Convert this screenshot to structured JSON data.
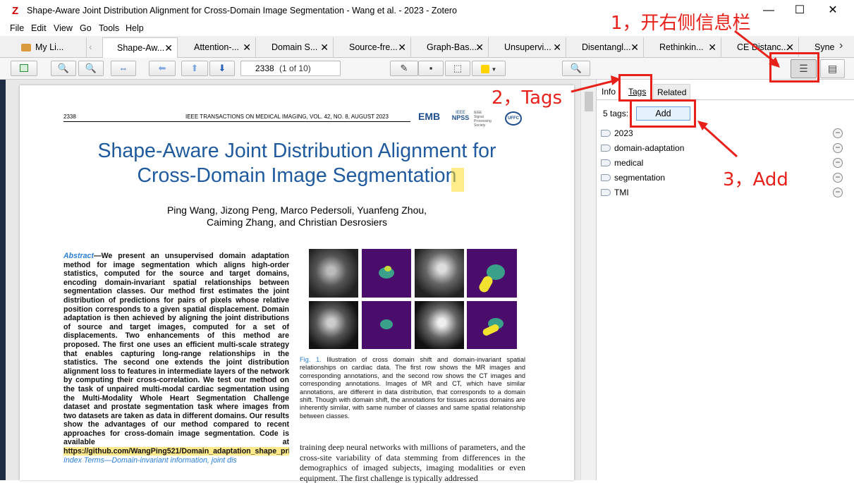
{
  "window": {
    "title": "Shape-Aware Joint Distribution Alignment for Cross-Domain Image Segmentation - Wang et al. - 2023 - Zotero",
    "app_icon": "zotero-z-icon",
    "minimize": "—",
    "maximize": "☐",
    "close": "✕"
  },
  "menu": [
    "File",
    "Edit",
    "View",
    "Go",
    "Tools",
    "Help"
  ],
  "tabs": [
    {
      "label": "My Li...",
      "icon": "library-icon"
    },
    {
      "label": "Shape-Aw...",
      "close": "✕"
    },
    {
      "label": "Attention-...",
      "close": "✕"
    },
    {
      "label": "Domain S...",
      "close": "✕"
    },
    {
      "label": "Source-fre...",
      "close": "✕"
    },
    {
      "label": "Graph-Bas...",
      "close": "✕"
    },
    {
      "label": "Unsupervi...",
      "close": "✕"
    },
    {
      "label": "Disentangl...",
      "close": "✕"
    },
    {
      "label": "Rethinkin...",
      "close": "✕"
    },
    {
      "label": "CE Distanc...",
      "close": "✕"
    },
    {
      "label": "Syne",
      "close": ""
    }
  ],
  "toolbar": {
    "page_value": "2338",
    "page_of": "(1 of 10)",
    "highlight_color": "#ffd400"
  },
  "pdf": {
    "header_left": "2338",
    "header_right": "IEEE TRANSACTIONS ON MEDICAL IMAGING, VOL. 42, NO. 8, AUGUST 2023",
    "logo_emb": "EMB",
    "logo_npss": "NPSS",
    "logo_ieee": "IEEE",
    "logo_sp": "Signal Processing Society",
    "logo_uffc": "UFFC",
    "title_line1": "Shape-Aware Joint Distribution Alignment for",
    "title_line2": "Cross-Domain Image Segmentation",
    "authors_line1": "Ping Wang, Jizong Peng, Marco Pedersoli, Yuanfeng Zhou,",
    "authors_line2": "Caiming Zhang, and Christian Desrosiers",
    "abstract_label": "Abstract",
    "abstract_text": "—We present an unsupervised domain adaptation method for image segmentation which aligns high-order statistics, computed for the source and target domains, encoding domain-invariant spatial relationships between segmentation classes. Our method first estimates the joint distribution of predictions for pairs of pixels whose relative position corresponds to a given spatial displacement. Domain adaptation is then achieved by aligning the joint distributions of source and target images, computed for a set of displacements. Two enhancements of this method are proposed. The first one uses an efficient multi-scale strategy that enables capturing long-range relationships in the statistics. The second one extends the joint distribution alignment loss to features in intermediate layers of the network by computing their cross-correlation. We test our method on the task of unpaired multi-modal cardiac segmentation using the Multi-Modality Whole Heart Segmentation Challenge dataset and prostate segmentation task where images from two datasets are taken as data in different domains. Our results show the advantages of our method compared to recent approaches for cross-domain image segmentation. Code is available at",
    "abstract_link": "https://github.com/WangPing521/Domain_adaptation_shape_prior",
    "index_terms": "Index Terms—Domain-invariant information, joint dis",
    "fig_label": "Fig. 1.",
    "fig_caption": "Illustration of cross domain shift and domain-invariant spatial relationships on cardiac data. The first row shows the MR images and corresponding annotations, and the second row shows the CT images and corresponding annotations. Images of MR and CT, which have similar annotations, are different in data distribution, that corresponds to a domain shift. Though with domain shift, the annotations for tissues across domains are inherently similar, with same number of classes and same spatial relationship between classes.",
    "body_text": "training deep neural networks with millions of parameters, and the cross-site variability of data stemming from differences in the demographics of imaged subjects, imaging modalities or even equipment. The first challenge is typically addressed"
  },
  "sidepane": {
    "tabs": [
      "Info",
      "Tags",
      "Related"
    ],
    "tag_count": "5 tags:",
    "add_label": "Add",
    "tags": [
      "2023",
      "domain-adaptation",
      "medical",
      "segmentation",
      "TMI"
    ]
  },
  "annotations": {
    "a1": "1，开右侧信息栏",
    "a2": "2，Tags",
    "a3": "3，Add"
  },
  "colors": {
    "annotation": "#e8201a",
    "title_blue": "#1f5a9e",
    "pdf_bg": "#e8e8e8"
  }
}
